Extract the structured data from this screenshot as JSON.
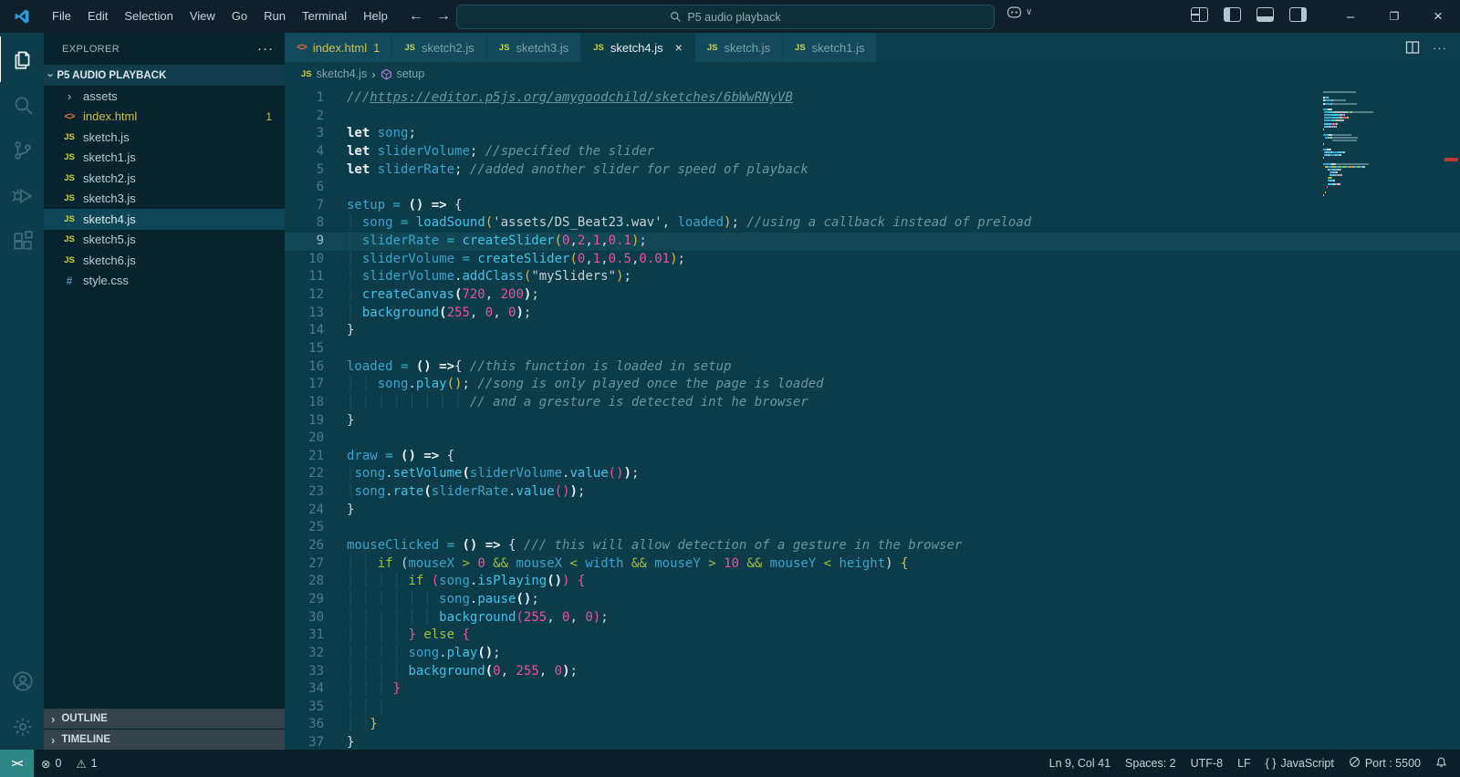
{
  "colors": {
    "titlebar_bg": "#0e2029",
    "editor_bg": "#0c3b49",
    "sidebar_bg": "#07232e",
    "activitybar_bg": "#0d3d4b",
    "tab_inactive_bg": "#124a5b",
    "statusbar_bg": "#0a2029",
    "remote_bg": "#2e8786",
    "accent_yellow": "#cfc04a",
    "number_pink": "#e8549c",
    "function_cyan": "#46c2e4",
    "variable_blue": "#3fa3c9",
    "operator_green": "#a3bf3b",
    "warning_marker_red": "#c0392f"
  },
  "titlebar": {
    "menus": [
      "File",
      "Edit",
      "Selection",
      "View",
      "Go",
      "Run",
      "Terminal",
      "Help"
    ],
    "back_arrow": "←",
    "forward_arrow": "→",
    "search": {
      "value": "P5 audio playback"
    }
  },
  "activitybar": {
    "items": [
      {
        "name": "explorer",
        "active": true
      },
      {
        "name": "search",
        "active": false
      },
      {
        "name": "source-control",
        "active": false
      },
      {
        "name": "run-and-debug",
        "active": false
      },
      {
        "name": "extensions",
        "active": false
      }
    ],
    "bottom": [
      {
        "name": "account"
      },
      {
        "name": "settings"
      }
    ]
  },
  "sidebar": {
    "header": "EXPLORER",
    "root": "P5 AUDIO PLAYBACK",
    "files": [
      {
        "icon": "chevron",
        "label": "assets"
      },
      {
        "icon": "html",
        "label": "index.html",
        "badge": "1",
        "modified": true
      },
      {
        "icon": "js",
        "label": "sketch.js"
      },
      {
        "icon": "js",
        "label": "sketch1.js"
      },
      {
        "icon": "js",
        "label": "sketch2.js"
      },
      {
        "icon": "js",
        "label": "sketch3.js"
      },
      {
        "icon": "js",
        "label": "sketch4.js",
        "selected": true
      },
      {
        "icon": "js",
        "label": "sketch5.js"
      },
      {
        "icon": "js",
        "label": "sketch6.js"
      },
      {
        "icon": "css",
        "label": "style.css"
      }
    ],
    "sections": [
      "OUTLINE",
      "TIMELINE"
    ]
  },
  "tabs": [
    {
      "icon": "html",
      "label": "index.html",
      "badge": "1",
      "modified": true
    },
    {
      "icon": "js",
      "label": "sketch2.js"
    },
    {
      "icon": "js",
      "label": "sketch3.js"
    },
    {
      "icon": "js",
      "label": "sketch4.js",
      "active": true,
      "close": "×"
    },
    {
      "icon": "js",
      "label": "sketch.js"
    },
    {
      "icon": "js",
      "label": "sketch1.js"
    }
  ],
  "breadcrumb": {
    "file": "sketch4.js",
    "separator": "›",
    "symbol": "setup"
  },
  "editor": {
    "lines": [
      {
        "t": [
          [
            "c",
            "///"
          ],
          [
            "cu",
            "https://editor.p5js.org/amygoodchild/sketches/6bWwRNyVB"
          ]
        ]
      },
      {
        "t": []
      },
      {
        "t": [
          [
            "k",
            "let"
          ],
          [
            "p",
            " "
          ],
          [
            "v",
            "song"
          ],
          [
            "p",
            ";"
          ]
        ]
      },
      {
        "t": [
          [
            "k",
            "let"
          ],
          [
            "p",
            " "
          ],
          [
            "v",
            "sliderVolume"
          ],
          [
            "p",
            "; "
          ],
          [
            "c",
            "//specified the slider"
          ]
        ]
      },
      {
        "t": [
          [
            "k",
            "let"
          ],
          [
            "p",
            " "
          ],
          [
            "v",
            "sliderRate"
          ],
          [
            "p",
            "; "
          ],
          [
            "c",
            "//added another slider for speed of playback"
          ]
        ]
      },
      {
        "t": []
      },
      {
        "t": [
          [
            "v",
            "setup"
          ],
          [
            "o",
            " = "
          ],
          [
            "w",
            "()"
          ],
          [
            "w",
            " => "
          ],
          [
            "p",
            "{"
          ]
        ]
      },
      {
        "t": [
          [
            "i",
            "│ "
          ],
          [
            "v",
            "song"
          ],
          [
            "o",
            " = "
          ],
          [
            "f",
            "loadSound"
          ],
          [
            "G",
            "("
          ],
          [
            "s",
            "'assets/DS_Beat23.wav'"
          ],
          [
            "p",
            ", "
          ],
          [
            "v",
            "loaded"
          ],
          [
            "G",
            ")"
          ],
          [
            "p",
            "; "
          ],
          [
            "c",
            "//using a callback instead of preload"
          ]
        ]
      },
      {
        "cur": true,
        "t": [
          [
            "i",
            "│ "
          ],
          [
            "v",
            "sliderRate"
          ],
          [
            "o",
            " = "
          ],
          [
            "f",
            "createSlider"
          ],
          [
            "G",
            "("
          ],
          [
            "n",
            "0"
          ],
          [
            "p",
            ","
          ],
          [
            "n",
            "2"
          ],
          [
            "p",
            ","
          ],
          [
            "n",
            "1"
          ],
          [
            "p",
            ","
          ],
          [
            "n",
            "0.1"
          ],
          [
            "G",
            ")"
          ],
          [
            "p",
            ";"
          ]
        ]
      },
      {
        "t": [
          [
            "i",
            "│ "
          ],
          [
            "v",
            "sliderVolume"
          ],
          [
            "o",
            " = "
          ],
          [
            "f",
            "createSlider"
          ],
          [
            "G",
            "("
          ],
          [
            "n",
            "0"
          ],
          [
            "p",
            ","
          ],
          [
            "n",
            "1"
          ],
          [
            "p",
            ","
          ],
          [
            "n",
            "0.5"
          ],
          [
            "p",
            ","
          ],
          [
            "n",
            "0.01"
          ],
          [
            "G",
            ")"
          ],
          [
            "p",
            ";"
          ]
        ]
      },
      {
        "t": [
          [
            "i",
            "│ "
          ],
          [
            "v",
            "sliderVolume"
          ],
          [
            "p",
            "."
          ],
          [
            "f",
            "addClass"
          ],
          [
            "G",
            "("
          ],
          [
            "s",
            "\"mySliders\""
          ],
          [
            "G",
            ")"
          ],
          [
            "p",
            ";"
          ]
        ]
      },
      {
        "t": [
          [
            "i",
            "│ "
          ],
          [
            "f",
            "createCanvas"
          ],
          [
            "w",
            "("
          ],
          [
            "n",
            "720"
          ],
          [
            "p",
            ", "
          ],
          [
            "n",
            "200"
          ],
          [
            "w",
            ")"
          ],
          [
            "p",
            ";"
          ]
        ]
      },
      {
        "t": [
          [
            "i",
            "│ "
          ],
          [
            "f",
            "background"
          ],
          [
            "w",
            "("
          ],
          [
            "n",
            "255"
          ],
          [
            "p",
            ", "
          ],
          [
            "n",
            "0"
          ],
          [
            "p",
            ", "
          ],
          [
            "n",
            "0"
          ],
          [
            "w",
            ")"
          ],
          [
            "p",
            ";"
          ]
        ]
      },
      {
        "t": [
          [
            "p",
            "}"
          ]
        ]
      },
      {
        "t": []
      },
      {
        "t": [
          [
            "v",
            "loaded"
          ],
          [
            "o",
            " = "
          ],
          [
            "w",
            "()"
          ],
          [
            "w",
            " =>"
          ],
          [
            "p",
            "{ "
          ],
          [
            "c",
            "//this function is loaded in setup"
          ]
        ]
      },
      {
        "t": [
          [
            "i",
            "│ │ "
          ],
          [
            "v",
            "song"
          ],
          [
            "p",
            "."
          ],
          [
            "f",
            "play"
          ],
          [
            "G",
            "()"
          ],
          [
            "p",
            "; "
          ],
          [
            "c",
            "//song is only played once the page is loaded"
          ]
        ]
      },
      {
        "t": [
          [
            "i",
            "│ │ │ │ │ │ │ │ "
          ],
          [
            "c",
            "// and a gresture is detected int he browser"
          ]
        ]
      },
      {
        "t": [
          [
            "p",
            "}"
          ]
        ]
      },
      {
        "t": []
      },
      {
        "t": [
          [
            "v",
            "draw"
          ],
          [
            "o",
            " = "
          ],
          [
            "w",
            "()"
          ],
          [
            "w",
            " => "
          ],
          [
            "p",
            "{"
          ]
        ]
      },
      {
        "t": [
          [
            "i",
            "│"
          ],
          [
            "v",
            "song"
          ],
          [
            "p",
            "."
          ],
          [
            "f",
            "setVolume"
          ],
          [
            "w",
            "("
          ],
          [
            "v",
            "sliderVolume"
          ],
          [
            "p",
            "."
          ],
          [
            "f",
            "value"
          ],
          [
            "P",
            "()"
          ],
          [
            "w",
            ")"
          ],
          [
            "p",
            ";"
          ]
        ]
      },
      {
        "t": [
          [
            "i",
            "│"
          ],
          [
            "v",
            "song"
          ],
          [
            "p",
            "."
          ],
          [
            "f",
            "rate"
          ],
          [
            "w",
            "("
          ],
          [
            "v",
            "sliderRate"
          ],
          [
            "p",
            "."
          ],
          [
            "f",
            "value"
          ],
          [
            "P",
            "()"
          ],
          [
            "w",
            ")"
          ],
          [
            "p",
            ";"
          ]
        ]
      },
      {
        "t": [
          [
            "p",
            "}"
          ]
        ]
      },
      {
        "t": []
      },
      {
        "t": [
          [
            "v",
            "mouseClicked"
          ],
          [
            "o",
            " = "
          ],
          [
            "w",
            "()"
          ],
          [
            "w",
            " => "
          ],
          [
            "p",
            "{ "
          ],
          [
            "c",
            "/// this will allow detection of a gesture in the browser"
          ]
        ]
      },
      {
        "t": [
          [
            "i",
            "│ │ "
          ],
          [
            "g",
            "if"
          ],
          [
            "p",
            " ("
          ],
          [
            "v",
            "mouseX"
          ],
          [
            "g",
            " > "
          ],
          [
            "n",
            "0"
          ],
          [
            "g",
            " && "
          ],
          [
            "v",
            "mouseX"
          ],
          [
            "g",
            " < "
          ],
          [
            "v",
            "width"
          ],
          [
            "g",
            " && "
          ],
          [
            "v",
            "mouseY"
          ],
          [
            "g",
            " > "
          ],
          [
            "n",
            "10"
          ],
          [
            "g",
            " && "
          ],
          [
            "v",
            "mouseY"
          ],
          [
            "g",
            " < "
          ],
          [
            "v",
            "height"
          ],
          [
            "p",
            ") "
          ],
          [
            "G",
            "{"
          ]
        ]
      },
      {
        "t": [
          [
            "i",
            "│ │ │ │ "
          ],
          [
            "g",
            "if"
          ],
          [
            "p",
            " "
          ],
          [
            "P",
            "("
          ],
          [
            "v",
            "song"
          ],
          [
            "p",
            "."
          ],
          [
            "f",
            "isPlaying"
          ],
          [
            "w",
            "()"
          ],
          [
            "P",
            ")"
          ],
          [
            "p",
            " "
          ],
          [
            "P",
            "{"
          ]
        ]
      },
      {
        "t": [
          [
            "i",
            "│ │ │ │ │ │ "
          ],
          [
            "v",
            "song"
          ],
          [
            "p",
            "."
          ],
          [
            "f",
            "pause"
          ],
          [
            "w",
            "()"
          ],
          [
            "p",
            ";"
          ]
        ]
      },
      {
        "t": [
          [
            "i",
            "│ │ │ │ │ │ "
          ],
          [
            "f",
            "background"
          ],
          [
            "P",
            "("
          ],
          [
            "n",
            "255"
          ],
          [
            "p",
            ", "
          ],
          [
            "n",
            "0"
          ],
          [
            "p",
            ", "
          ],
          [
            "n",
            "0"
          ],
          [
            "P",
            ")"
          ],
          [
            "p",
            ";"
          ]
        ]
      },
      {
        "t": [
          [
            "i",
            "│ │ │ │ "
          ],
          [
            "P",
            "}"
          ],
          [
            "g",
            " else "
          ],
          [
            "P",
            "{"
          ]
        ]
      },
      {
        "t": [
          [
            "i",
            "│ │ │ │ "
          ],
          [
            "v",
            "song"
          ],
          [
            "p",
            "."
          ],
          [
            "f",
            "play"
          ],
          [
            "w",
            "()"
          ],
          [
            "p",
            ";"
          ]
        ]
      },
      {
        "t": [
          [
            "i",
            "│ │ │ │ "
          ],
          [
            "f",
            "background"
          ],
          [
            "w",
            "("
          ],
          [
            "n",
            "0"
          ],
          [
            "p",
            ", "
          ],
          [
            "n",
            "255"
          ],
          [
            "p",
            ", "
          ],
          [
            "n",
            "0"
          ],
          [
            "w",
            ")"
          ],
          [
            "p",
            ";"
          ]
        ]
      },
      {
        "t": [
          [
            "i",
            "│ │ │ "
          ],
          [
            "P",
            "}"
          ]
        ]
      },
      {
        "t": [
          [
            "i",
            "│ │ │"
          ]
        ]
      },
      {
        "t": [
          [
            "i",
            "│ │"
          ],
          [
            "G",
            "}"
          ]
        ]
      },
      {
        "t": [
          [
            "p",
            "}"
          ]
        ]
      }
    ]
  },
  "statusbar": {
    "remote": "><",
    "left": [
      {
        "name": "errors",
        "icon": "error-icon",
        "glyph": "⊗",
        "text": "0"
      },
      {
        "name": "warnings",
        "icon": "warning-icon",
        "glyph": "⚠",
        "text": "1"
      }
    ],
    "right": [
      {
        "name": "cursor-position",
        "text": "Ln 9, Col 41"
      },
      {
        "name": "indentation",
        "text": "Spaces: 2"
      },
      {
        "name": "encoding",
        "text": "UTF-8"
      },
      {
        "name": "eol",
        "text": "LF"
      },
      {
        "name": "language-mode",
        "glyph": "{ }",
        "text": "JavaScript"
      },
      {
        "name": "live-server-port",
        "icon": "circle-slash-icon",
        "text": "Port : 5500"
      },
      {
        "name": "notifications",
        "icon": "bell-icon",
        "text": ""
      }
    ]
  }
}
